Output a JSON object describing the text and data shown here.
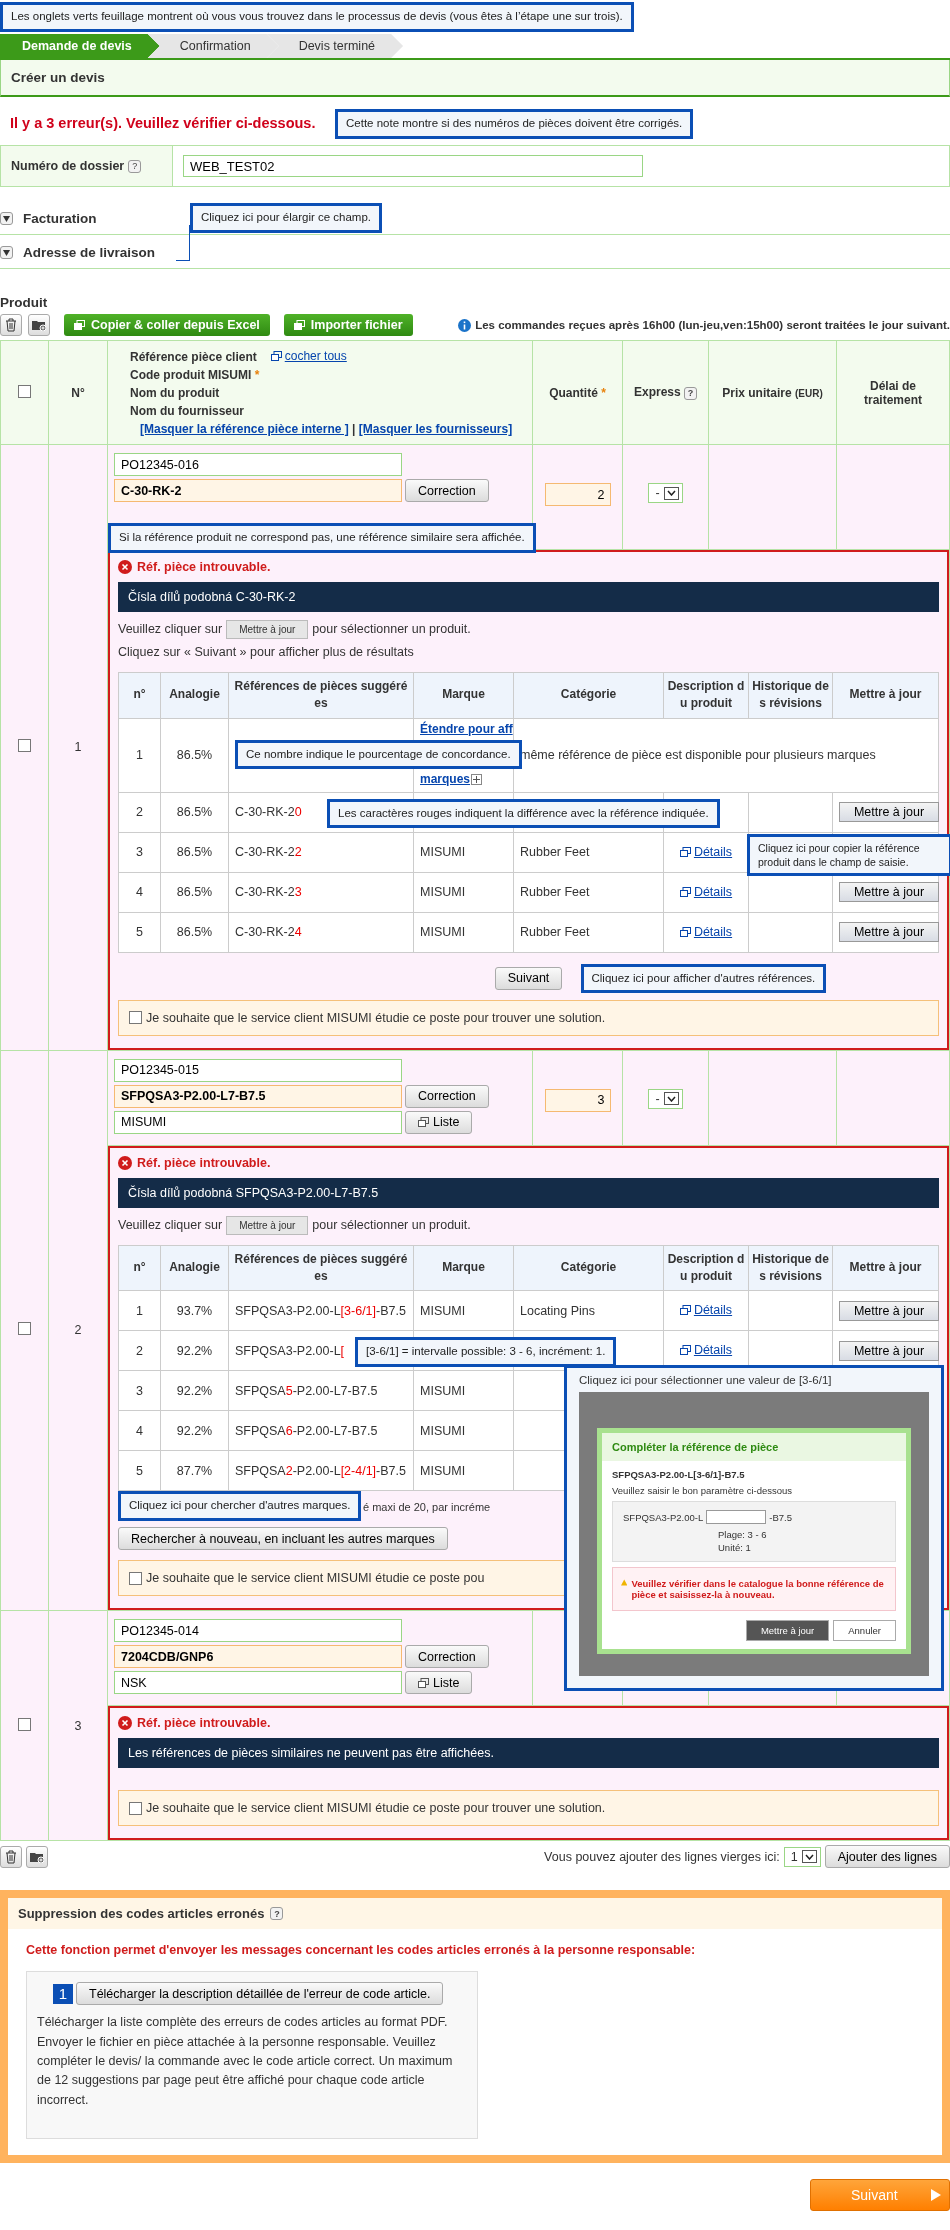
{
  "notes": [
    "Les onglets verts feuillage montrent où vous vous trouvez dans le processus de devis (vous êtes à l’étape une sur trois).",
    "Cette note montre si des numéros de pièces doivent être corrigés.",
    "Cliquez ici pour élargir ce champ.",
    "Si la référence produit ne correspond pas, une référence similaire sera affichée.",
    "Ce nombre indique le pourcentage de concordance.",
    "Les caractères rouges indiquent la différence avec la référence indiquée.",
    "Cliquez ici pour copier la référence produit dans le champ de saisie.",
    "Cliquez ici pour afficher d'autres références.",
    "[3-6/1] = intervalle possible: 3 - 6, incrément: 1.",
    "Cliquez ici pour chercher d'autres marques."
  ],
  "steps": [
    {
      "label": "Demande de devis",
      "selected": true
    },
    {
      "label": "Confirmation",
      "selected": false
    },
    {
      "label": "Devis terminé",
      "selected": false
    }
  ],
  "title": "Créer un devis",
  "error_message": "Il y a 3 erreur(s). Veuillez vérifier ci-dessous.",
  "dossier": {
    "label": "Numéro de dossier",
    "help": "?",
    "value": "WEB_TEST02"
  },
  "sections": [
    {
      "label": "Facturation"
    },
    {
      "label": "Adresse de livraison"
    }
  ],
  "product": {
    "title": "Produit",
    "buttons": [
      "Copier & coller depuis Excel",
      "Importer fichier"
    ],
    "info": "Les commandes reçues après 16h00 (lun-jeu,ven:15h00) seront traitées le jour suivant."
  },
  "header": {
    "checked": false,
    "no": "N°",
    "lines": [
      {
        "text": "Référence pièce client"
      },
      {
        "text": "Code produit MISUMI",
        "marker": "*"
      },
      {
        "text": "Nom du produit"
      },
      {
        "text": "Nom du fournisseur"
      }
    ],
    "check_all": "cocher tous",
    "links": [
      "[Masquer la référence pièce interne ]",
      "[Masquer les fournisseurs]"
    ],
    "separator": "|",
    "qty": "Quantité",
    "qty_marker": "*",
    "express": "Express",
    "express_help": "?",
    "price": "Prix unitaire",
    "price_unit": "(EUR)",
    "delay": "Délai de traitement"
  },
  "rows": [
    {
      "no": "1",
      "checked": false,
      "customer_ref": "PO12345-016",
      "code": "C-30-RK-2",
      "correction": "Correction",
      "qty": "2",
      "express": "-",
      "error": {
        "title": "Réf. pièce introuvable.",
        "header": "Čísla dílů podobná C-30-RK-2",
        "instruction": [
          "Veuillez cliquer sur",
          "Mettre à jour",
          "pour sélectionner un produit."
        ],
        "instruction_2": "Cliquez sur « Suivant » pour afficher plus de résultats",
        "columns": [
          "n°",
          "Analogie",
          "Références de pièces suggérées",
          "Marque",
          "Catégorie",
          "Description du produit",
          "Historique des révisions",
          "Mettre à jour"
        ],
        "suggestions": [
          {
            "kind": "multi",
            "no": "1",
            "analogy": "86.5%",
            "expand": [
              "Étendre pour aff",
              "marques"
            ],
            "message": "même référence de pièce est disponible pour plusieurs marques"
          },
          {
            "kind": "single",
            "no": "2",
            "analogy": "86.5%",
            "ref": [
              {
                "text": "C-30-RK-2",
                "diff": false
              },
              {
                "text": "0",
                "diff": true
              }
            ],
            "update": "Mettre à jour"
          },
          {
            "kind": "single",
            "no": "3",
            "analogy": "86.5%",
            "ref": [
              {
                "text": "C-30-RK-2",
                "diff": false
              },
              {
                "text": "2",
                "diff": true
              }
            ],
            "brand": "MISUMI",
            "category": "Rubber Feet",
            "details": "Détails"
          },
          {
            "kind": "single",
            "no": "4",
            "analogy": "86.5%",
            "ref": [
              {
                "text": "C-30-RK-2",
                "diff": false
              },
              {
                "text": "3",
                "diff": true
              }
            ],
            "brand": "MISUMI",
            "category": "Rubber Feet",
            "details": "Détails",
            "update": "Mettre à jour"
          },
          {
            "kind": "single",
            "no": "5",
            "analogy": "86.5%",
            "ref": [
              {
                "text": "C-30-RK-2",
                "diff": false
              },
              {
                "text": "4",
                "diff": true
              }
            ],
            "brand": "MISUMI",
            "category": "Rubber Feet",
            "details": "Détails",
            "update": "Mettre à jour"
          }
        ],
        "next": "Suivant",
        "request": "Je souhaite que le service client MISUMI étudie ce poste pour trouver une solution.",
        "request_checked": false
      }
    },
    {
      "no": "2",
      "checked": false,
      "customer_ref": "PO12345-015",
      "code": "SFPQSA3-P2.00-L7-B7.5",
      "correction": "Correction",
      "supplier": "MISUMI",
      "list": "Liste",
      "qty": "3",
      "express": "-",
      "error": {
        "title": "Réf. pièce introuvable.",
        "header": "Čísla dílů podobná SFPQSA3-P2.00-L7-B7.5",
        "instruction": [
          "Veuillez cliquer sur",
          "Mettre à jour",
          "pour sélectionner un produit."
        ],
        "columns": [
          "n°",
          "Analogie",
          "Références de pièces suggérées",
          "Marque",
          "Catégorie",
          "Description du produit",
          "Historique des révisions",
          "Mettre à jour"
        ],
        "suggestions": [
          {
            "kind": "single",
            "no": "1",
            "analogy": "93.7%",
            "ref": [
              {
                "text": "SFPQSA3-P2.00-L",
                "diff": false
              },
              {
                "text": "[3-6/1]",
                "diff": true
              },
              {
                "text": "-B7.5",
                "diff": false
              }
            ],
            "brand": "MISUMI",
            "category": "Locating Pins",
            "details": "Détails",
            "update": "Mettre à jour"
          },
          {
            "kind": "single",
            "no": "2",
            "analogy": "92.2%",
            "ref": [
              {
                "text": "SFPQSA3-P2.00-L",
                "diff": false
              },
              {
                "text": "[",
                "diff": true
              }
            ],
            "details": "Détails",
            "update": "Mettre à jour"
          },
          {
            "kind": "single",
            "no": "3",
            "analogy": "92.2%",
            "ref": [
              {
                "text": "SFPQSA",
                "diff": false
              },
              {
                "text": "5",
                "diff": true
              },
              {
                "text": "-P2.00-L7-B7.5",
                "diff": false
              }
            ],
            "brand": "MISUMI"
          },
          {
            "kind": "single",
            "no": "4",
            "analogy": "92.2%",
            "ref": [
              {
                "text": "SFPQSA",
                "diff": false
              },
              {
                "text": "6",
                "diff": true
              },
              {
                "text": "-P2.00-L7-B7.5",
                "diff": false
              }
            ],
            "brand": "MISUMI"
          },
          {
            "kind": "single",
            "no": "5",
            "analogy": "87.7%",
            "ref": [
              {
                "text": "SFPQSA",
                "diff": false
              },
              {
                "text": "2",
                "diff": true
              },
              {
                "text": "-P2.00-L",
                "diff": false
              },
              {
                "text": "[2-4/1]",
                "diff": true
              },
              {
                "text": "-B7.5",
                "diff": false
              }
            ],
            "brand": "MISUMI"
          }
        ],
        "limit_note": "é maxi de 20, par incréme",
        "research": "Rechercher à nouveau, en incluant les autres marques",
        "request": "Je souhaite que le service client MISUMI étudie ce poste pou",
        "request_checked": false,
        "inset": {
          "title": "Cliquez ici pour sélectionner une valeur de [3-6/1]",
          "dialog_title": "Compléter la référence de pièce",
          "ref": "SFPQSA3-P2.00-L[3-6/1]-B7.5",
          "instruction": "Veuillez saisir le bon paramètre ci-dessous",
          "prefix": "SFPQSA3-P2.00-L",
          "suffix": "-B7.5",
          "range": "Plage: 3 - 6",
          "unit": "Unité: 1",
          "warning": "Veuillez vérifier dans le catalogue la bonne référence de pièce et saisissez-la à nouveau.",
          "buttons": [
            "Mettre à jour",
            "Annuler"
          ]
        }
      }
    },
    {
      "no": "3",
      "checked": false,
      "customer_ref": "PO12345-014",
      "code": "7204CDB/GNP6",
      "correction": "Correction",
      "supplier": "NSK",
      "list": "Liste",
      "error": {
        "title": "Réf. pièce introuvable.",
        "header": "Les références de pièces similaires ne peuvent pas être affichées.",
        "request": "Je souhaite que le service client MISUMI étudie ce poste pour trouver une solution.",
        "request_checked": false
      }
    }
  ],
  "add_lines": {
    "label": "Vous pouvez ajouter des lignes vierges ici:",
    "count": "1",
    "button": "Ajouter des lignes"
  },
  "errors_section": {
    "title": "Suppression des codes articles erronés",
    "help": "?",
    "message": "Cette fonction permet d'envoyer les messages concernant les codes articles erronés à la personne responsable:",
    "step": "1",
    "button": "Télécharger la description détaillée de l'erreur de code article.",
    "description": "Télécharger la liste complète des erreurs de codes articles au format PDF. Envoyer le fichier en pièce attachée à la personne responsable. Veuillez compléter le devis/ la commande avec le code article correct. Un maximum de 12 suggestions par page peut être affiché pour chaque code article incorrect."
  },
  "next": "Suivant"
}
